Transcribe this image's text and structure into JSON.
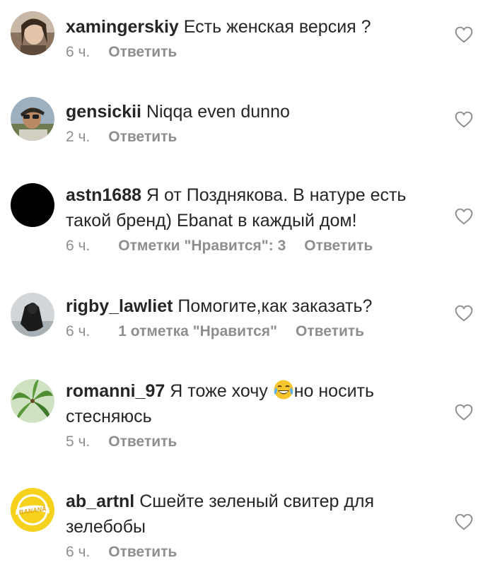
{
  "comments": [
    {
      "username": "xamingerskiy",
      "text": "Есть женская версия ?",
      "time": "6 ч.",
      "likes": "",
      "reply": "Ответить",
      "avatar_icon": "user-photo-avatar"
    },
    {
      "username": "gensickii",
      "text": "Niqqa even dunno",
      "time": "2 ч.",
      "likes": "",
      "reply": "Ответить",
      "avatar_icon": "user-photo-avatar"
    },
    {
      "username": "astn1688",
      "text": "Я от Позднякова. В натуре есть такой бренд) Ebanat в каждый дом!",
      "time": "6 ч.",
      "likes": "Отметки \"Нравится\": 3",
      "reply": "Ответить",
      "avatar_icon": "black-circle-avatar"
    },
    {
      "username": "rigby_lawliet",
      "text": "Помогите,как заказать?",
      "time": "6 ч.",
      "likes": "1 отметка \"Нравится\"",
      "reply": "Ответить",
      "avatar_icon": "user-photo-avatar"
    },
    {
      "username": "romanni_97",
      "text_before_emoji": "Я тоже хочу",
      "text_after_emoji": "но носить стесняюсь",
      "emoji_icon": "laughing-crying-emoji-icon",
      "time": "5 ч.",
      "likes": "",
      "reply": "Ответить",
      "avatar_icon": "palm-tree-avatar"
    },
    {
      "username": "ab_artnl",
      "text": "Сшейте зеленый свитер для зелебобы",
      "time": "6 ч.",
      "likes": "",
      "reply": "Ответить",
      "avatar_icon": "banana-logo-avatar",
      "avatar_text": "BANANA"
    }
  ],
  "heart_icon": "heart-outline-icon"
}
